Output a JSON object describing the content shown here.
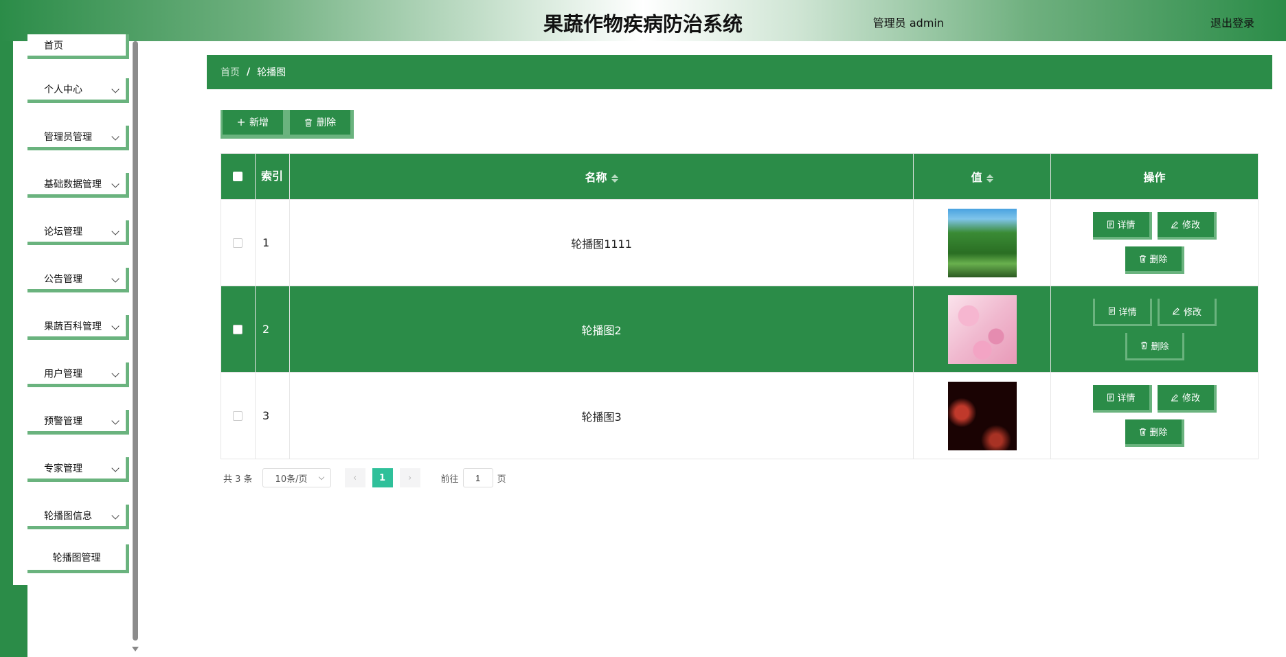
{
  "header": {
    "title": "果蔬作物疾病防治系统",
    "user_label": "管理员 admin",
    "logout_label": "退出登录"
  },
  "sidebar": {
    "items": [
      {
        "label": "首页"
      },
      {
        "label": "个人中心"
      },
      {
        "label": "管理员管理"
      },
      {
        "label": "基础数据管理"
      },
      {
        "label": "论坛管理"
      },
      {
        "label": "公告管理"
      },
      {
        "label": "果蔬百科管理"
      },
      {
        "label": "用户管理"
      },
      {
        "label": "预警管理"
      },
      {
        "label": "专家管理"
      },
      {
        "label": "轮播图信息"
      }
    ],
    "sub_item": {
      "label": "轮播图管理"
    }
  },
  "breadcrumb": {
    "home": "首页",
    "separator": "/",
    "current": "轮播图"
  },
  "toolbar": {
    "add_label": "新增",
    "delete_label": "删除"
  },
  "table": {
    "headers": {
      "index": "索引",
      "name": "名称",
      "value": "值",
      "ops": "操作"
    },
    "rows": [
      {
        "index": "1",
        "name": "轮播图1111",
        "image": "forest"
      },
      {
        "index": "2",
        "name": "轮播图2",
        "image": "cherry-blossom"
      },
      {
        "index": "3",
        "name": "轮播图3",
        "image": "lanterns"
      }
    ],
    "actions": {
      "detail": "详情",
      "edit": "修改",
      "delete": "删除"
    }
  },
  "pagination": {
    "total": "共 3 条",
    "page_size": "10条/页",
    "current_page": "1",
    "goto_label": "前往",
    "goto_value": "1",
    "page_suffix": "页"
  },
  "colors": {
    "primary": "#2b8c48",
    "accent": "#6ab37e",
    "pager_active": "#2fc09a"
  }
}
